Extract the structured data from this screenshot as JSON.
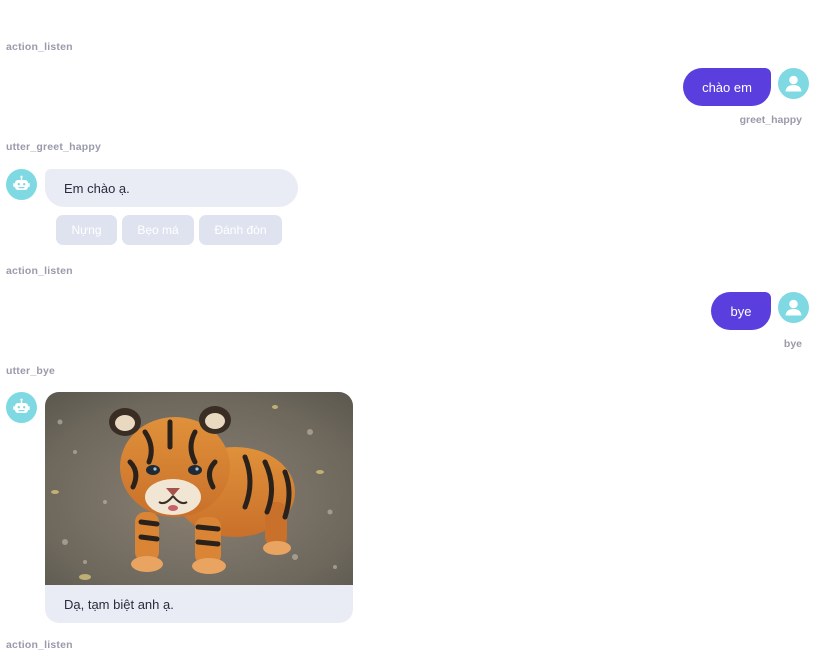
{
  "colors": {
    "user_bubble": "#5a3fde",
    "bot_bubble": "#e9ecf5",
    "avatar": "#7ed9e2",
    "label": "#9a9aab",
    "quick_reply": "#dfe3ef"
  },
  "conversation": {
    "action_1": "action_listen",
    "user_msg_1": {
      "text": "chào em",
      "intent": "greet_happy"
    },
    "action_2": "utter_greet_happy",
    "bot_msg_1": {
      "text": "Em chào ạ.",
      "quick_replies": [
        "Nựng",
        "Bẹo má",
        "Đánh đòn"
      ]
    },
    "action_3": "action_listen",
    "user_msg_2": {
      "text": "bye",
      "intent": "bye"
    },
    "action_4": "utter_bye",
    "bot_msg_2": {
      "image_icon": "tiger-cub-photo",
      "caption": "Dạ, tạm biệt anh ạ."
    },
    "action_5": "action_listen"
  }
}
